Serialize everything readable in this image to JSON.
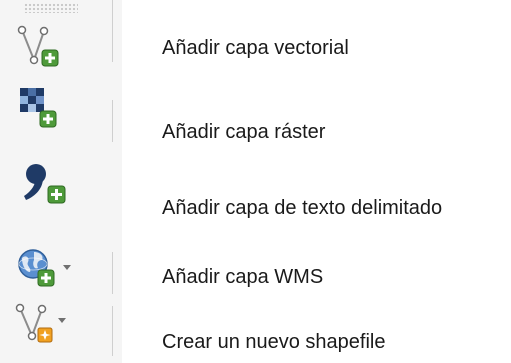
{
  "toolbar": {
    "items": [
      {
        "label": "Añadir capa vectorial",
        "icon": "add-vector-layer-icon",
        "has_dropdown": false
      },
      {
        "label": "Añadir capa ráster",
        "icon": "add-raster-layer-icon",
        "has_dropdown": false
      },
      {
        "label": "Añadir capa de texto delimitado",
        "icon": "add-delimited-text-layer-icon",
        "has_dropdown": false
      },
      {
        "label": "Añadir capa WMS",
        "icon": "add-wms-layer-icon",
        "has_dropdown": true
      },
      {
        "label": "Crear un nuevo shapefile",
        "icon": "new-shapefile-icon",
        "has_dropdown": true
      }
    ]
  },
  "colors": {
    "plus_badge": "#4e9a3a",
    "new_badge": "#f0a020",
    "raster_dark": "#1f3a66",
    "comma_shape": "#1f3a66"
  }
}
